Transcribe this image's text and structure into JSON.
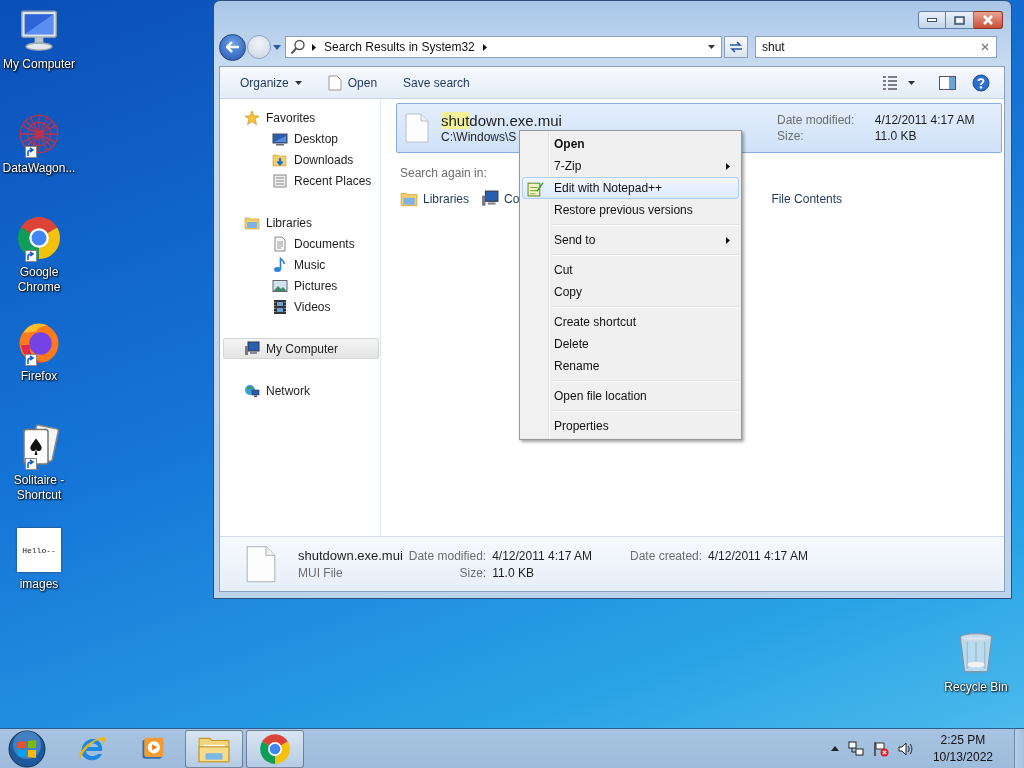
{
  "desktop_icons": [
    {
      "label": "My Computer",
      "kind": "computer",
      "shortcut": false
    },
    {
      "label": "DataWagon...",
      "kind": "mesh",
      "shortcut": true
    },
    {
      "label": "Google Chrome",
      "kind": "chrome",
      "shortcut": true
    },
    {
      "label": "Firefox",
      "kind": "firefox",
      "shortcut": true
    },
    {
      "label": "Solitaire - Shortcut",
      "kind": "cards",
      "shortcut": true
    },
    {
      "label": "images",
      "kind": "thumbnail",
      "thumbnail_text": "Hello--",
      "shortcut": false
    }
  ],
  "recycle_bin": {
    "label": "Recycle Bin"
  },
  "explorer": {
    "address": {
      "crumb": "Search Results in System32"
    },
    "search": {
      "value": "shut"
    },
    "toolbar": [
      {
        "label": "Organize",
        "kind": "menu"
      },
      {
        "label": "Open",
        "kind": "open"
      },
      {
        "label": "Save search",
        "kind": "plain"
      }
    ],
    "nav": [
      {
        "label": "Favorites",
        "kind": "star",
        "selected": false,
        "children": [
          {
            "label": "Desktop",
            "kind": "desktop",
            "selected": false
          },
          {
            "label": "Downloads",
            "kind": "downloads",
            "selected": false
          },
          {
            "label": "Recent Places",
            "kind": "recent",
            "selected": false
          }
        ]
      },
      {
        "label": "Libraries",
        "kind": "library",
        "selected": false,
        "children": [
          {
            "label": "Documents",
            "kind": "document",
            "selected": false
          },
          {
            "label": "Music",
            "kind": "music",
            "selected": false
          },
          {
            "label": "Pictures",
            "kind": "image",
            "selected": false
          },
          {
            "label": "Videos",
            "kind": "film",
            "selected": false
          }
        ]
      },
      {
        "label": "My Computer",
        "kind": "computer",
        "selected": true
      },
      {
        "label": "Network",
        "kind": "network",
        "selected": false
      }
    ],
    "results": [
      {
        "name_match": "shut",
        "name_rest": "down.exe.mui",
        "path": "C:\\Windows\\S",
        "selected": true,
        "fields": [
          {
            "label": "Date modified:",
            "value": "4/12/2011 4:17 AM"
          },
          {
            "label": "Size:",
            "value": "11.0 KB"
          }
        ]
      }
    ],
    "search_again": {
      "label": "Search again in:",
      "locations": [
        {
          "label": "Libraries",
          "kind": "library"
        },
        {
          "label": "Co",
          "kind": "computer"
        },
        {
          "label": "File Contents",
          "kind": "none"
        }
      ]
    },
    "details": {
      "name": "shutdown.exe.mui",
      "type": "MUI File",
      "fields": [
        {
          "label": "Date modified:",
          "value": "4/12/2011 4:17 AM"
        },
        {
          "label": "Date created:",
          "value": "4/12/2011 4:17 AM"
        },
        {
          "label": "Size:",
          "value": "11.0 KB"
        }
      ]
    }
  },
  "context_menu": {
    "items": [
      {
        "kind": "item",
        "label": "Open",
        "default": true,
        "submenu": false,
        "selected": false
      },
      {
        "kind": "item",
        "label": "7-Zip",
        "default": false,
        "submenu": true,
        "selected": false
      },
      {
        "kind": "icon_item",
        "label": "Edit with Notepad++",
        "default": false,
        "submenu": false,
        "selected": true
      },
      {
        "kind": "item",
        "label": "Restore previous versions",
        "default": false,
        "submenu": false,
        "selected": false
      },
      {
        "kind": "separator"
      },
      {
        "kind": "item",
        "label": "Send to",
        "default": false,
        "submenu": true,
        "selected": false
      },
      {
        "kind": "separator"
      },
      {
        "kind": "item",
        "label": "Cut",
        "default": false,
        "submenu": false,
        "selected": false
      },
      {
        "kind": "item",
        "label": "Copy",
        "default": false,
        "submenu": false,
        "selected": false
      },
      {
        "kind": "separator"
      },
      {
        "kind": "item",
        "label": "Create shortcut",
        "default": false,
        "submenu": false,
        "selected": false
      },
      {
        "kind": "item",
        "label": "Delete",
        "default": false,
        "submenu": false,
        "selected": false
      },
      {
        "kind": "item",
        "label": "Rename",
        "default": false,
        "submenu": false,
        "selected": false
      },
      {
        "kind": "separator"
      },
      {
        "kind": "item",
        "label": "Open file location",
        "default": false,
        "submenu": false,
        "selected": false
      },
      {
        "kind": "separator"
      },
      {
        "kind": "item",
        "label": "Properties",
        "default": false,
        "submenu": false,
        "selected": false
      }
    ]
  },
  "taskbar": {
    "apps": [
      {
        "kind": "ie",
        "running": false
      },
      {
        "kind": "media",
        "running": false
      },
      {
        "kind": "folder",
        "running": true
      },
      {
        "kind": "chrome",
        "running": true
      }
    ],
    "clock": {
      "time": "2:25 PM",
      "date": "10/13/2022"
    }
  }
}
